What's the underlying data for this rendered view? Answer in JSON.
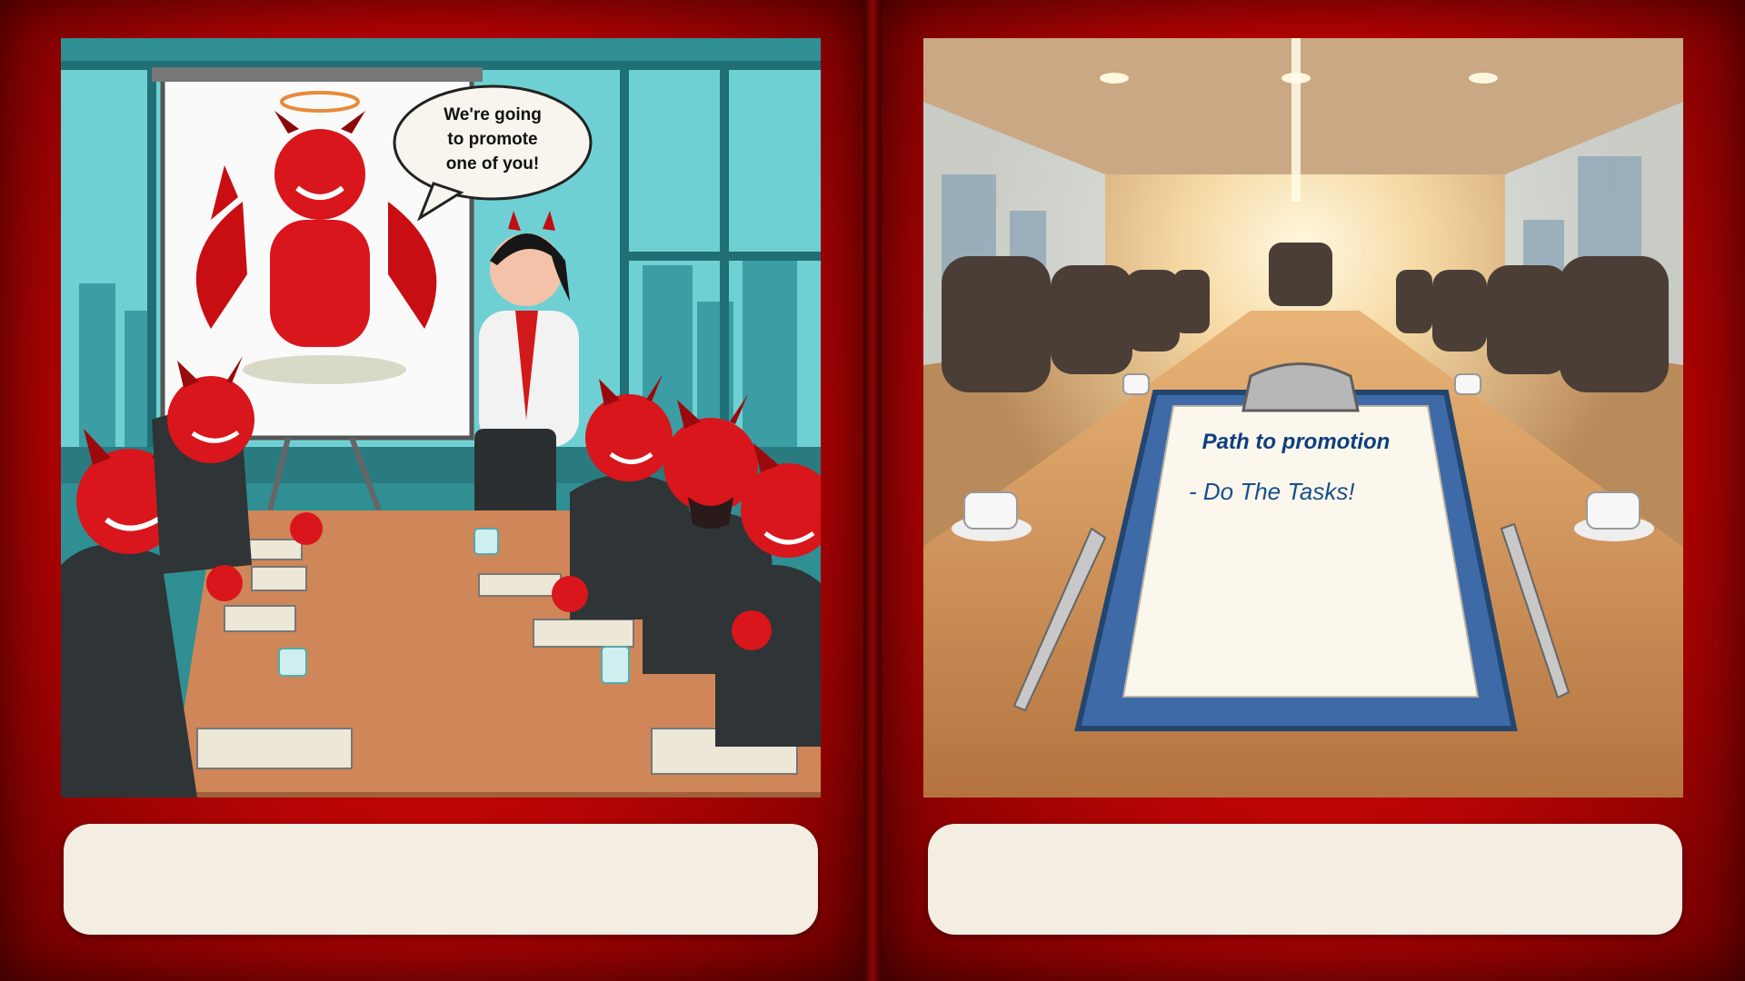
{
  "left_panel": {
    "speech_bubble": {
      "lines": [
        "We're going",
        "to promote",
        "one of you!"
      ]
    },
    "caption": ""
  },
  "right_panel": {
    "clipboard": {
      "title": "Path to promotion",
      "task": "- Do The Tasks!"
    },
    "caption": ""
  },
  "colors": {
    "panel_red": "#c20404",
    "devil_red": "#d8161c",
    "caption_bg": "#f3ede2",
    "clipboard_blue": "#3f6aa8"
  }
}
